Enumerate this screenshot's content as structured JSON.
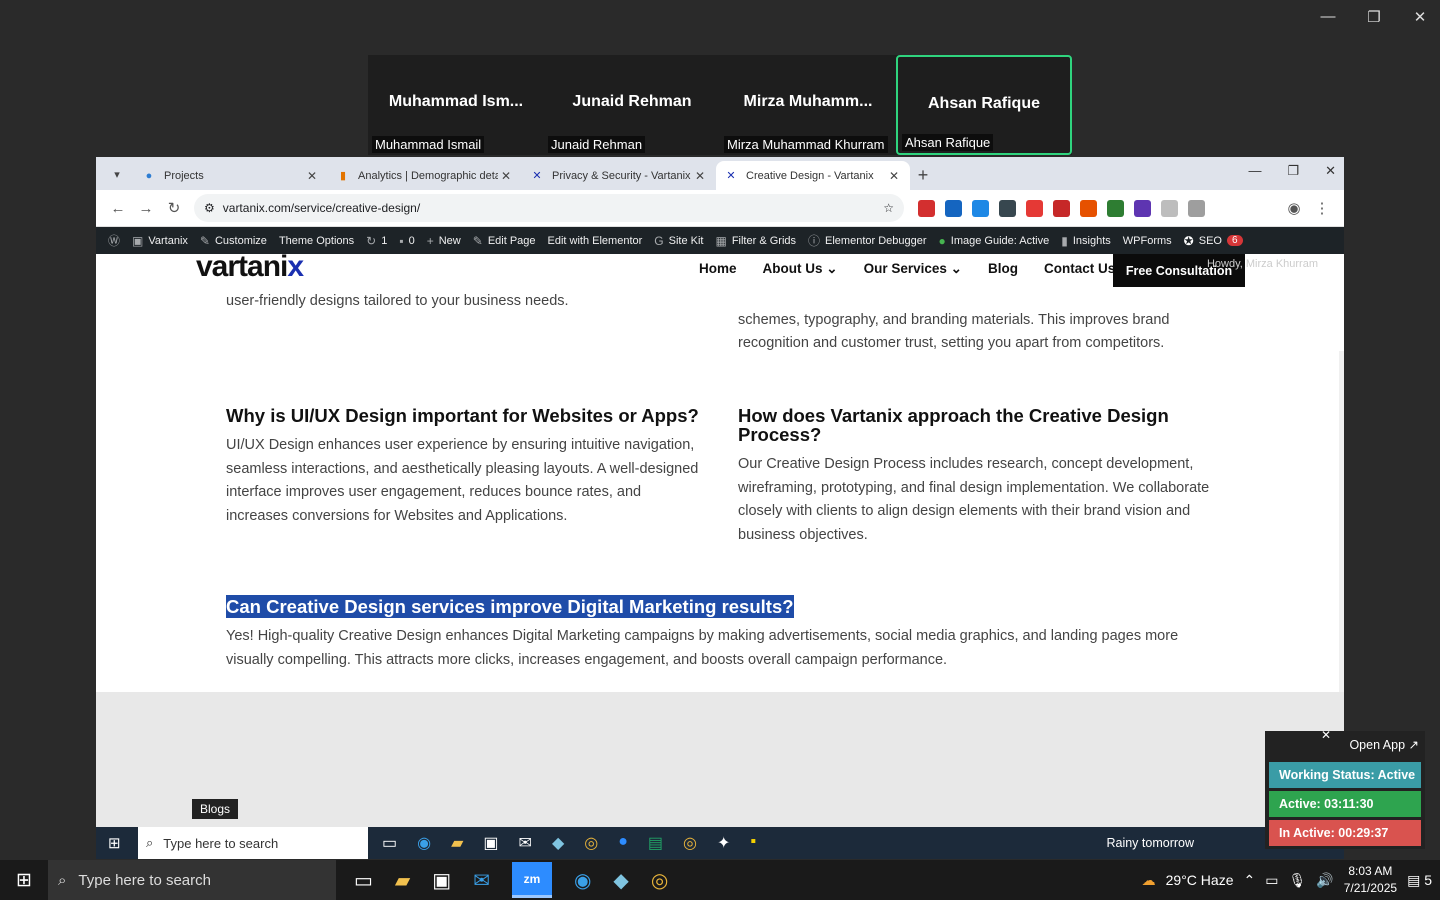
{
  "outer_window": {
    "minimize": "—",
    "restore": "❐",
    "close": "✕"
  },
  "participants": [
    {
      "big": "Muhammad  Ism...",
      "small": "Muhammad Ismail",
      "active": false
    },
    {
      "big": "Junaid Rehman",
      "small": "Junaid Rehman",
      "active": false
    },
    {
      "big": "Mirza  Muhamm...",
      "small": "Mirza Muhammad Khurram",
      "active": false
    },
    {
      "big": "Ahsan Rafique",
      "small": "Ahsan Rafique",
      "active": true
    }
  ],
  "browser": {
    "tabs": [
      {
        "title": "Projects",
        "icon": "app-icon",
        "color": "#2d7dd2"
      },
      {
        "title": "Analytics | Demographic details",
        "icon": "analytics-icon",
        "color": "#e37400"
      },
      {
        "title": "Privacy & Security - Vartanix",
        "icon": "vartanix-icon",
        "color": "#1a2fb0"
      },
      {
        "title": "Creative Design - Vartanix",
        "icon": "vartanix-icon",
        "color": "#1a2fb0"
      }
    ],
    "url": "vartanix.com/service/creative-design/",
    "extensions": [
      "#d32f2f",
      "#1565c0",
      "#1e88e5",
      "#37474f",
      "#e53935",
      "#c62828",
      "#e65100",
      "#2e7d32",
      "#5e35b1",
      "#bdbdbd",
      "#9e9e9e"
    ]
  },
  "wp_admin_bar": {
    "site": "Vartanix",
    "customize": "Customize",
    "theme_options": "Theme Options",
    "updates": "1",
    "comments": "0",
    "new": "New",
    "edit_page": "Edit Page",
    "elementor": "Edit with Elementor",
    "site_kit": "Site Kit",
    "filter_grids": "Filter & Grids",
    "debugger": "Elementor Debugger",
    "image_guide": "Image Guide: Active",
    "insights": "Insights",
    "wpforms": "WPForms",
    "seo": "SEO",
    "seo_count": "6"
  },
  "site": {
    "logo_main": "vartani",
    "logo_x": "x",
    "nav": [
      "Home",
      "About Us",
      "Our Services",
      "Blog",
      "Contact Us"
    ],
    "cta": "Free Consultation",
    "howdy": "Howdy, Mirza Khurram",
    "faq": {
      "q0_tail": "user-friendly designs tailored to your business needs.",
      "a0_right_1": "schemes, typography, and branding materials. This improves brand",
      "a0_right_2": "recognition and customer trust, setting you apart from competitors.",
      "q1": "Why is UI/UX Design important for Websites or Apps?",
      "a1": "UI/UX Design enhances user experience by ensuring intuitive navigation, seamless interactions, and aesthetically pleasing layouts. A well-designed interface improves user engagement, reduces bounce rates, and increases conversions for Websites and Applications.",
      "q2": "How does Vartanix approach the Creative Design Process?",
      "a2": "Our Creative Design Process includes research, concept development, wireframing, prototyping, and final design implementation. We collaborate closely with clients to align design elements with their brand vision and business objectives.",
      "q3": "Can Creative Design services improve Digital Marketing results?",
      "a3": "Yes! High-quality Creative Design enhances Digital Marketing campaigns by making advertisements, social media graphics, and landing pages more visually compelling. This attracts more clicks, increases engagement, and boosts overall campaign performance."
    },
    "blogs_tag": "Blogs"
  },
  "inner_taskbar": {
    "search_placeholder": "Type here to search",
    "weather": "Rainy tomorrow"
  },
  "tracker": {
    "open_app": "Open App ↗",
    "close": "✕",
    "working_status": "Working Status: Active",
    "active": "Active: 03:11:30",
    "inactive": "In Active: 00:29:37",
    "colors": {
      "status": "#3a9ca6",
      "active": "#2ea44f",
      "inactive": "#d9534f"
    }
  },
  "taskbar": {
    "search_placeholder": "Type here to search",
    "weather": "29°C  Haze",
    "time": "8:03 AM",
    "date": "7/21/2025",
    "notifications": "5"
  }
}
